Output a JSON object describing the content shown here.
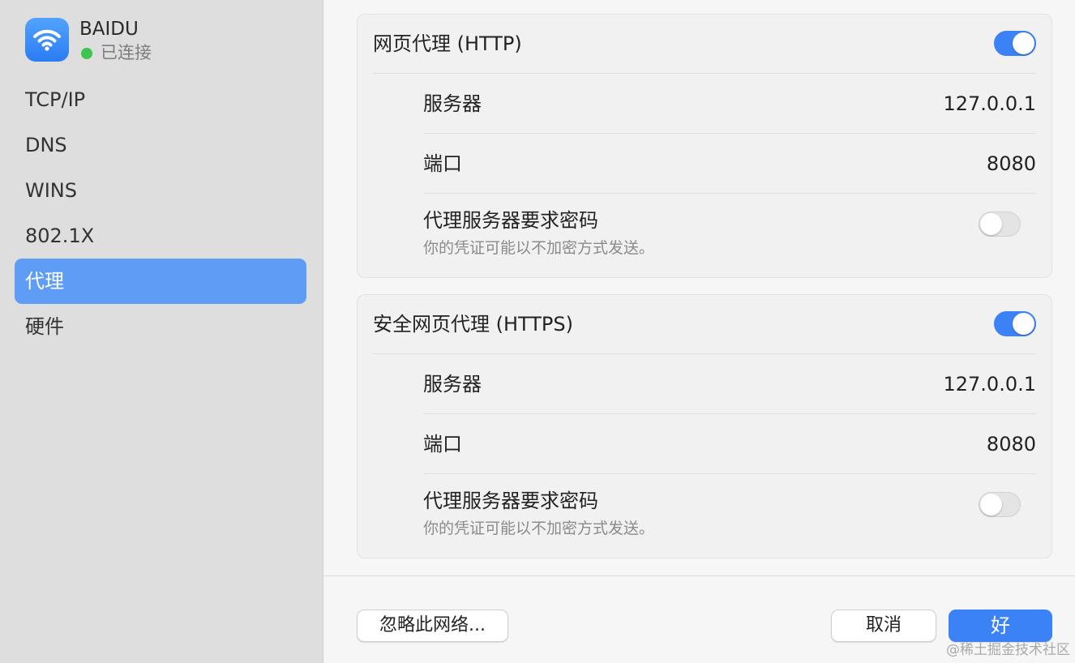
{
  "network": {
    "name": "BAIDU",
    "status": "已连接",
    "icon": "wifi-icon",
    "status_color": "#3dc54f"
  },
  "sidebar": {
    "items": [
      {
        "label": "TCP/IP"
      },
      {
        "label": "DNS"
      },
      {
        "label": "WINS"
      },
      {
        "label": "802.1X"
      },
      {
        "label": "代理",
        "selected": true
      },
      {
        "label": "硬件"
      }
    ],
    "accent": "#5e9cf5"
  },
  "http_proxy": {
    "title": "网页代理 (HTTP)",
    "enabled": true,
    "server_label": "服务器",
    "server_value": "127.0.0.1",
    "port_label": "端口",
    "port_value": "8080",
    "password_label": "代理服务器要求密码",
    "password_note": "你的凭证可能以不加密方式发送。",
    "password_required": false
  },
  "https_proxy": {
    "title": "安全网页代理 (HTTPS)",
    "enabled": true,
    "server_label": "服务器",
    "server_value": "127.0.0.1",
    "port_label": "端口",
    "port_value": "8080",
    "password_label": "代理服务器要求密码",
    "password_note": "你的凭证可能以不加密方式发送。",
    "password_required": false
  },
  "footer": {
    "forget_label": "忽略此网络...",
    "cancel_label": "取消",
    "ok_label": "好"
  },
  "watermark": "@稀土掘金技术社区",
  "colors": {
    "toggle_on": "#3b82f6",
    "primary_button": "#3b82f6"
  }
}
